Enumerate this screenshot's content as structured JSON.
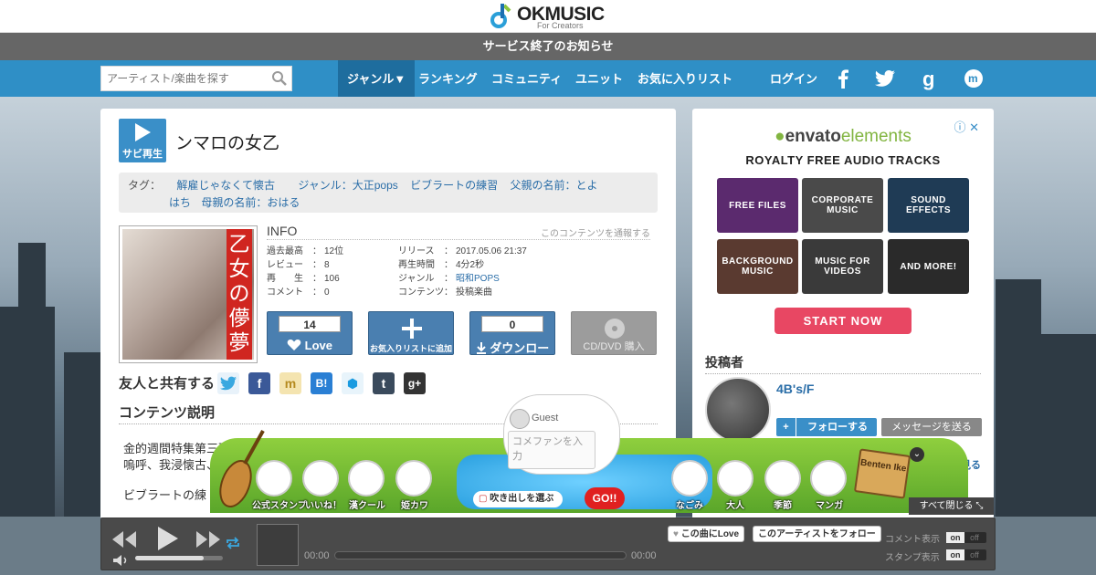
{
  "logo": {
    "name": "OKMUSIC",
    "sub": "For Creators"
  },
  "notice": "サービス終了のお知らせ",
  "nav": {
    "search_placeholder": "アーティスト/楽曲を探す",
    "items": [
      "ジャンル▼",
      "ランキング",
      "コミュニティ",
      "ユニット",
      "お気に入りリスト"
    ],
    "login": "ログイン",
    "social": [
      "facebook-icon",
      "twitter-icon",
      "google-icon",
      "okmusic-icon"
    ]
  },
  "song": {
    "preview_label": "サビ再生",
    "title": "ンマロの女乙",
    "tags_label": "タグ：",
    "tags": [
      "解雇じゃなくて懐古",
      "ジャンル：大正pops",
      "ビブラートの練習",
      "父親の名前：とよ",
      "はち",
      "母親の名前：おはる"
    ],
    "jacket_text": "乙女の儚夢",
    "info_heading": "INFO",
    "report": "このコンテンツを通報する",
    "info_left": [
      {
        "k": "過去最高",
        "v": "12位"
      },
      {
        "k": "レビュー",
        "v": "8"
      },
      {
        "k": "再　　生",
        "v": "106"
      },
      {
        "k": "コメント",
        "v": "0"
      }
    ],
    "info_right": [
      {
        "k": "リリース",
        "v": "2017.05.06 21:37"
      },
      {
        "k": "再生時間",
        "v": "4分2秒"
      },
      {
        "k": "ジャンル",
        "v": "昭和POPS"
      },
      {
        "k": "コンテンツ",
        "v": "投稿楽曲"
      }
    ],
    "love_count": "14",
    "love_label": "Love",
    "fav_label": "お気入りリストに追加",
    "dl_count": "0",
    "dl_label": "ダウンロード",
    "cd_label": "CD/DVD 購入",
    "share_label": "友人と共有する",
    "desc_heading": "コンテンツ説明",
    "desc_lines": [
      "金的週間特集第三弾",
      "嗚呼、我浸懐古、…",
      "ビブラートの練"
    ]
  },
  "ad": {
    "brand_a": "envato",
    "brand_b": "elements",
    "tagline": "ROYALTY FREE AUDIO TRACKS",
    "tiles": [
      "FREE FILES",
      "CORPORATE MUSIC",
      "SOUND EFFECTS",
      "BACKGROUND MUSIC",
      "MUSIC FOR VIDEOS",
      "AND MORE!"
    ],
    "cta": "START NOW",
    "tile_colors": [
      "#5b2a6e",
      "#4a4a4a",
      "#1f3b55",
      "#5a3a30",
      "#3a3a3a",
      "#2a2a2a"
    ]
  },
  "poster": {
    "heading": "投稿者",
    "name": "4B's/F",
    "follow": "フォローする",
    "message": "メッセージを送る",
    "more": "もっと見る"
  },
  "stamps": {
    "left": [
      "公式スタンプ",
      "いいね！",
      "漢クール",
      "姫カワ"
    ],
    "right": [
      "なごみ",
      "大人",
      "季節",
      "マンガ"
    ],
    "guest": "Guest",
    "comment_placeholder": "コメファンを入力",
    "bubble": "吹き出しを選ぶ",
    "go": "GO!!",
    "close_all": "すべて閉じる",
    "sign": "Benten Ike"
  },
  "player": {
    "time_start": "00:00",
    "time_end": "00:00",
    "love_btn": "この曲にLove",
    "follow_btn": "このアーティストをフォロー",
    "comment_toggle": "コメント表示",
    "stamp_toggle": "スタンプ表示",
    "on": "on",
    "off": "off"
  }
}
